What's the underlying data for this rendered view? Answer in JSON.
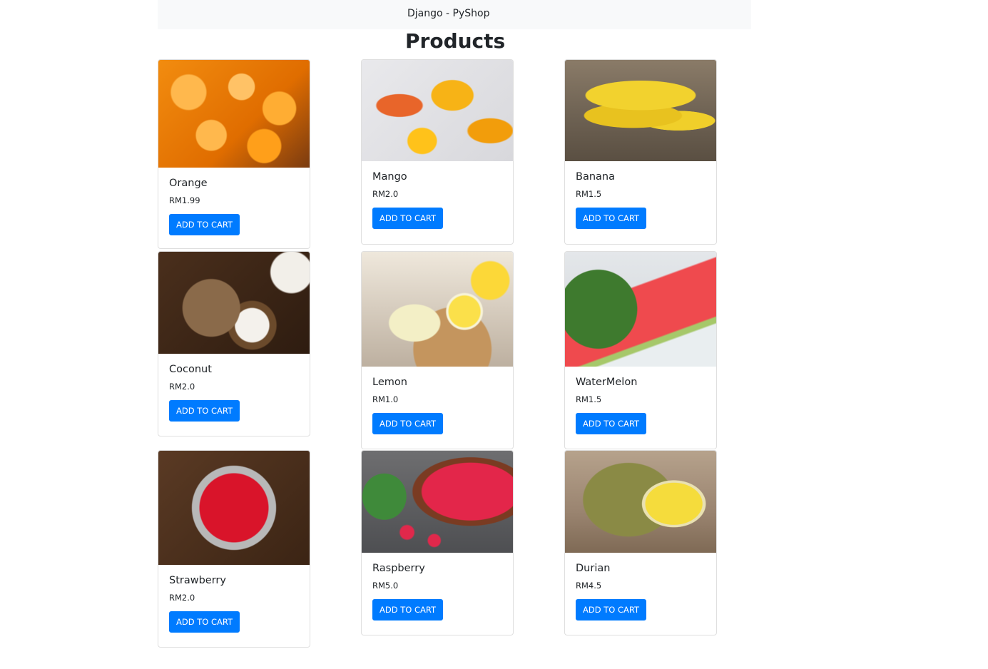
{
  "navbar": {
    "brand": "Django - PyShop"
  },
  "page": {
    "title": "Products"
  },
  "products": [
    {
      "name": "Orange",
      "price": "RM1.99",
      "button": "ADD TO CART"
    },
    {
      "name": "Mango",
      "price": "RM2.0",
      "button": "ADD TO CART"
    },
    {
      "name": "Banana",
      "price": "RM1.5",
      "button": "ADD TO CART"
    },
    {
      "name": "Coconut",
      "price": "RM2.0",
      "button": "ADD TO CART"
    },
    {
      "name": "Lemon",
      "price": "RM1.0",
      "button": "ADD TO CART"
    },
    {
      "name": "WaterMelon",
      "price": "RM1.5",
      "button": "ADD TO CART"
    },
    {
      "name": "Strawberry",
      "price": "RM2.0",
      "button": "ADD TO CART"
    },
    {
      "name": "Raspberry",
      "price": "RM5.0",
      "button": "ADD TO CART"
    },
    {
      "name": "Durian",
      "price": "RM4.5",
      "button": "ADD TO CART"
    }
  ]
}
